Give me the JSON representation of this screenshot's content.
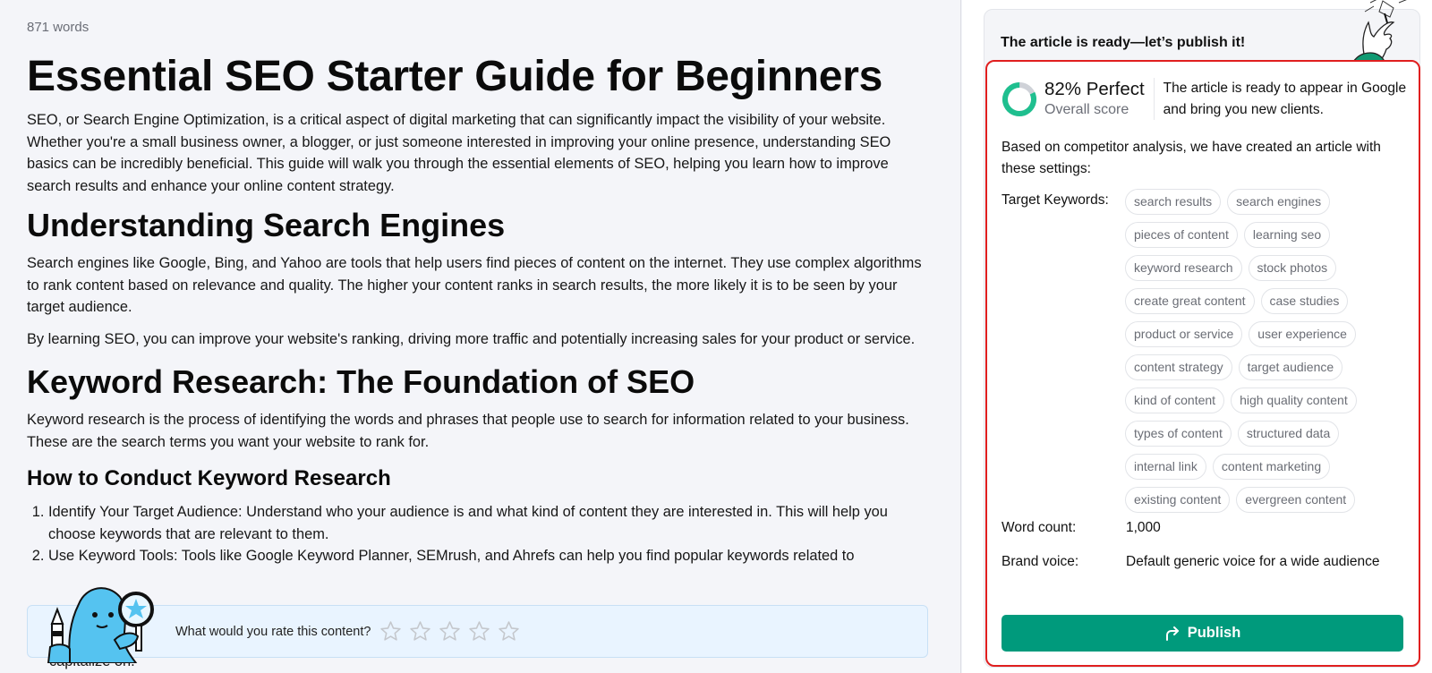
{
  "editor": {
    "word_count": "871 words",
    "title": "Essential SEO Starter Guide for Beginners",
    "intro": "SEO, or Search Engine Optimization, is a critical aspect of digital marketing that can significantly impact the visibility of your website. Whether you're a small business owner, a blogger, or just someone interested in improving your online presence, understanding SEO basics can be incredibly beneficial. This guide will walk you through the essential elements of SEO, helping you learn how to improve search results and enhance your online content strategy.",
    "section1": {
      "heading": "Understanding Search Engines",
      "p1": "Search engines like Google, Bing, and Yahoo are tools that help users find pieces of content on the internet. They use complex algorithms to rank content based on relevance and quality. The higher your content ranks in search results, the more likely it is to be seen by your target audience.",
      "p2": "By learning SEO, you can improve your website's ranking, driving more traffic and potentially increasing sales for your product or service."
    },
    "section2": {
      "heading": "Keyword Research: The Foundation of SEO",
      "p1": "Keyword research is the process of identifying the words and phrases that people use to search for information related to your business. These are the search terms you want your website to rank for.",
      "subheading": "How to Conduct Keyword Research",
      "steps": [
        "Identify Your Target Audience: Understand who your audience is and what kind of content they are interested in. This will help you choose keywords that are relevant to them.",
        "Use Keyword Tools: Tools like Google Keyword Planner, SEMrush, and Ahrefs can help you find popular keywords related to"
      ],
      "trailing_text": "capitalize on."
    }
  },
  "rating": {
    "prompt": "What would you rate this content?",
    "max_stars": 5,
    "current": 0,
    "star_color": "#c4c7cc"
  },
  "panel": {
    "title": "The article is ready—let’s publish it!",
    "score": {
      "value": 82,
      "label": "82% Perfect",
      "sublabel": "Overall score",
      "description": "The article is ready to appear in Google and bring you new clients.",
      "ring_color": "#1fbf8f",
      "track_color": "#cfd2d8"
    },
    "based_text": "Based on competitor analysis, we have created an article with these settings:",
    "keywords_label": "Target Keywords:",
    "keywords": [
      "search results",
      "search engines",
      "pieces of content",
      "learning seo",
      "keyword research",
      "stock photos",
      "create great content",
      "case studies",
      "product or service",
      "user experience",
      "content strategy",
      "target audience",
      "kind of content",
      "high quality content",
      "types of content",
      "structured data",
      "internal link",
      "content marketing",
      "existing content",
      "evergreen content"
    ],
    "word_count_label": "Word count:",
    "word_count_value": "1,000",
    "brand_voice_label": "Brand voice:",
    "brand_voice_value": "Default generic voice for a wide audience",
    "publish_label": "Publish",
    "accent_color": "#009a7c",
    "highlight_border_color": "#e01f1f"
  }
}
